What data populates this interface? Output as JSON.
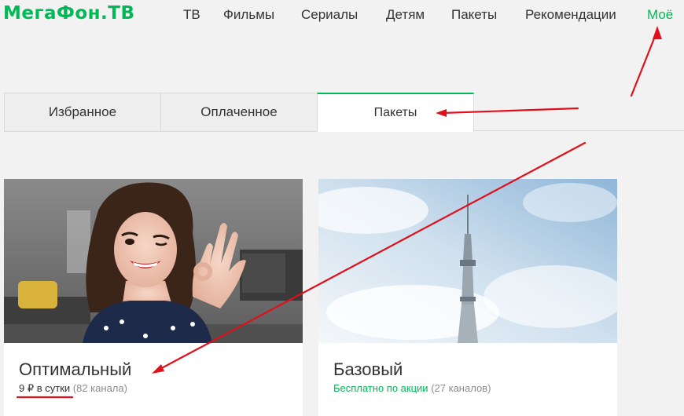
{
  "header": {
    "logo": "МегаФон.ТВ",
    "nav": [
      {
        "label": "ТВ"
      },
      {
        "label": "Фильмы"
      },
      {
        "label": "Сериалы"
      },
      {
        "label": "Детям"
      },
      {
        "label": "Пакеты"
      },
      {
        "label": "Рекомендации"
      },
      {
        "label": "Моё"
      }
    ]
  },
  "tabs": [
    {
      "label": "Избранное"
    },
    {
      "label": "Оплаченное"
    },
    {
      "label": "Пакеты"
    }
  ],
  "packages": [
    {
      "title": "Оптимальный",
      "price": "9 ₽ в сутки",
      "channels": "(82 канала)"
    },
    {
      "title": "Базовый",
      "price": "Бесплатно по акции",
      "channels": "(27 каналов)"
    }
  ],
  "colors": {
    "brand": "#00b956",
    "annotation": "#e0101b"
  }
}
